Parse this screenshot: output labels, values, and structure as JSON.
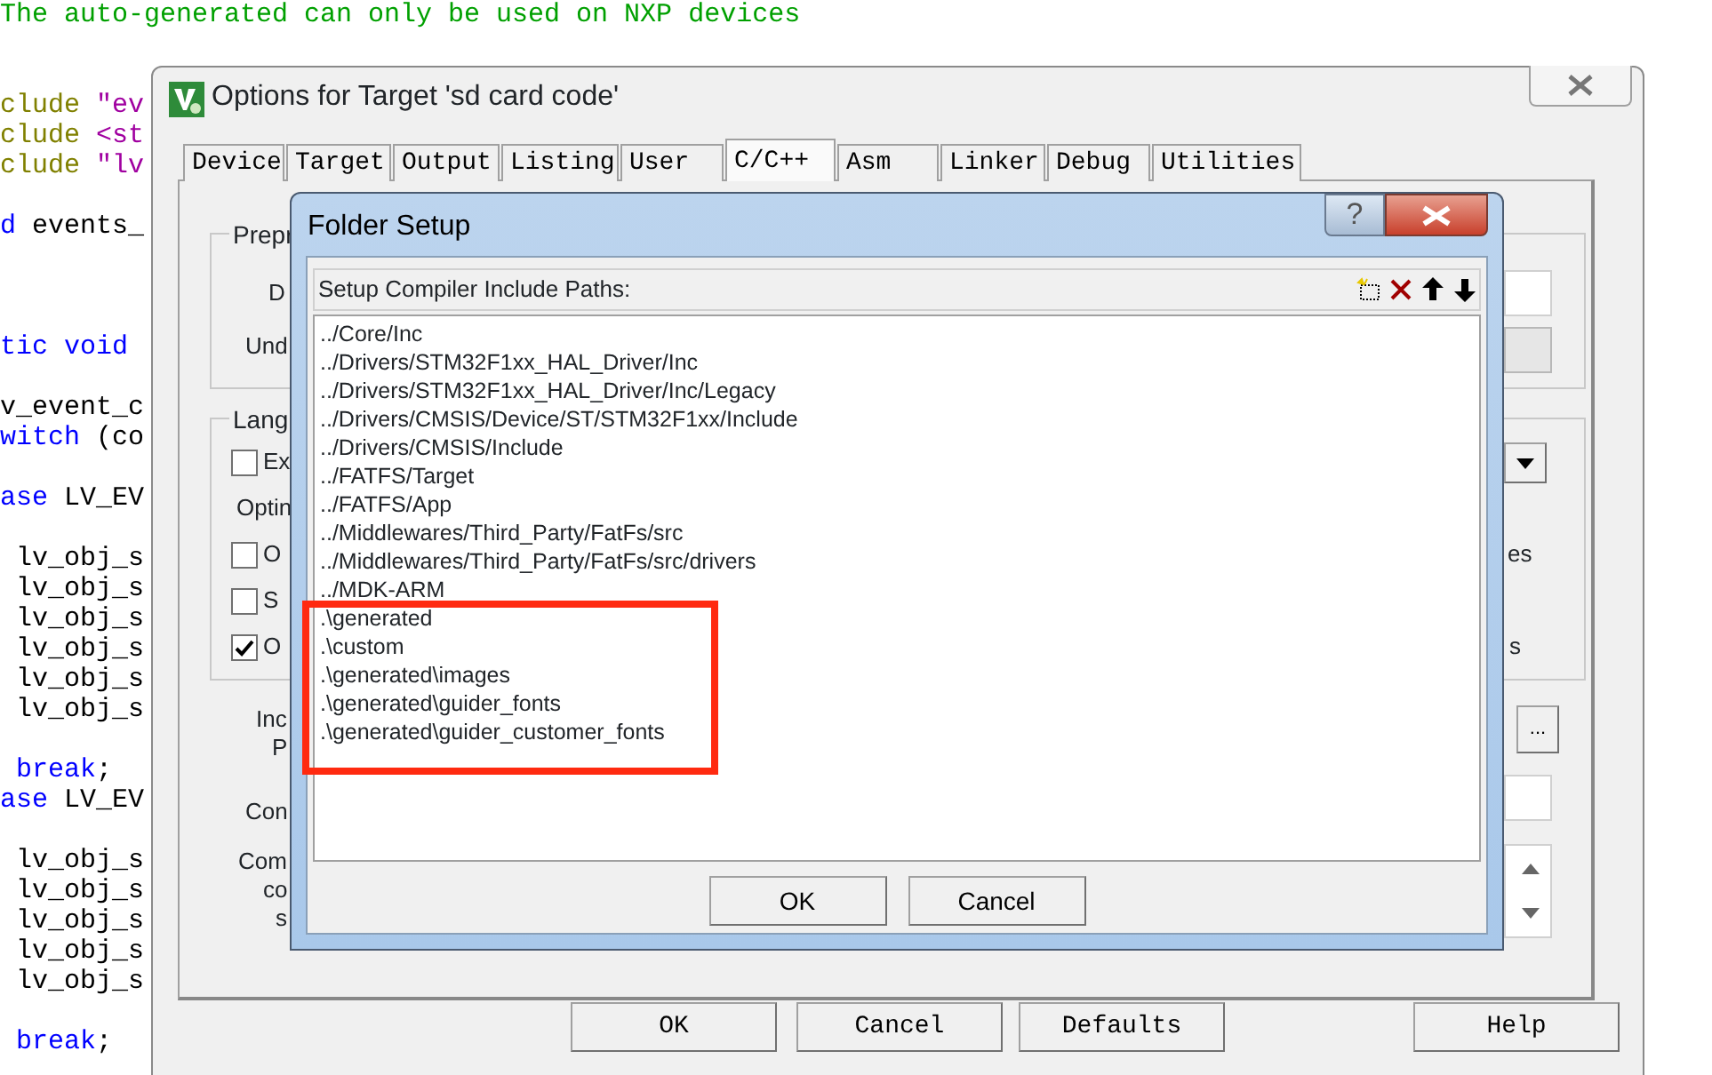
{
  "editor": {
    "lines": [
      {
        "kind": "code",
        "segments": [
          {
            "kind": "comment",
            "text": "The auto-generated can only be used on NXP devices"
          }
        ]
      },
      {
        "kind": "blank"
      },
      {
        "kind": "blank"
      },
      {
        "kind": "code",
        "segments": [
          {
            "kind": "preproc",
            "text": "clude "
          },
          {
            "kind": "string",
            "text": "\"ev"
          }
        ]
      },
      {
        "kind": "code",
        "segments": [
          {
            "kind": "preproc",
            "text": "clude "
          },
          {
            "kind": "string",
            "text": "<st"
          }
        ]
      },
      {
        "kind": "code",
        "segments": [
          {
            "kind": "preproc",
            "text": "clude "
          },
          {
            "kind": "string",
            "text": "\"lv"
          }
        ]
      },
      {
        "kind": "blank"
      },
      {
        "kind": "code",
        "segments": [
          {
            "kind": "keyword",
            "text": "d "
          },
          {
            "kind": "plain",
            "text": "events_"
          }
        ]
      },
      {
        "kind": "blank"
      },
      {
        "kind": "blank"
      },
      {
        "kind": "blank"
      },
      {
        "kind": "code",
        "segments": [
          {
            "kind": "keyword",
            "text": "tic void"
          }
        ]
      },
      {
        "kind": "blank"
      },
      {
        "kind": "code",
        "segments": [
          {
            "kind": "plain",
            "text": "v_event_c"
          }
        ]
      },
      {
        "kind": "code",
        "segments": [
          {
            "kind": "keyword",
            "text": "witch"
          },
          {
            "kind": "plain",
            "text": " (co"
          }
        ]
      },
      {
        "kind": "blank"
      },
      {
        "kind": "code",
        "segments": [
          {
            "kind": "keyword",
            "text": "ase"
          },
          {
            "kind": "plain",
            "text": " LV_EV"
          }
        ]
      },
      {
        "kind": "blank"
      },
      {
        "kind": "code",
        "segments": [
          {
            "kind": "plain",
            "text": " lv_obj_s"
          }
        ]
      },
      {
        "kind": "code",
        "segments": [
          {
            "kind": "plain",
            "text": " lv_obj_s"
          }
        ]
      },
      {
        "kind": "code",
        "segments": [
          {
            "kind": "plain",
            "text": " lv_obj_s"
          }
        ]
      },
      {
        "kind": "code",
        "segments": [
          {
            "kind": "plain",
            "text": " lv_obj_s"
          }
        ]
      },
      {
        "kind": "code",
        "segments": [
          {
            "kind": "plain",
            "text": " lv_obj_s"
          }
        ]
      },
      {
        "kind": "code",
        "segments": [
          {
            "kind": "plain",
            "text": " lv_obj_s"
          }
        ]
      },
      {
        "kind": "blank"
      },
      {
        "kind": "code",
        "segments": [
          {
            "kind": "keyword",
            "text": " break"
          },
          {
            "kind": "plain",
            "text": ";"
          }
        ]
      },
      {
        "kind": "code",
        "segments": [
          {
            "kind": "keyword",
            "text": "ase"
          },
          {
            "kind": "plain",
            "text": " LV_EV"
          }
        ]
      },
      {
        "kind": "blank"
      },
      {
        "kind": "code",
        "segments": [
          {
            "kind": "plain",
            "text": " lv_obj_s"
          }
        ]
      },
      {
        "kind": "code",
        "segments": [
          {
            "kind": "plain",
            "text": " lv_obj_s"
          }
        ]
      },
      {
        "kind": "code",
        "segments": [
          {
            "kind": "plain",
            "text": " lv_obj_s"
          }
        ]
      },
      {
        "kind": "code",
        "segments": [
          {
            "kind": "plain",
            "text": " lv_obj_s"
          }
        ]
      },
      {
        "kind": "code",
        "segments": [
          {
            "kind": "plain",
            "text": " lv_obj_s"
          }
        ]
      },
      {
        "kind": "blank"
      },
      {
        "kind": "code",
        "segments": [
          {
            "kind": "keyword",
            "text": " break"
          },
          {
            "kind": "plain",
            "text": ";"
          }
        ]
      }
    ]
  },
  "options_dialog": {
    "title": "Options for Target 'sd card code'",
    "tabs": [
      {
        "label": "Device",
        "selected": false
      },
      {
        "label": "Target",
        "selected": false
      },
      {
        "label": "Output",
        "selected": false
      },
      {
        "label": "Listing",
        "selected": false
      },
      {
        "label": "User",
        "selected": false
      },
      {
        "label": "C/C++",
        "selected": true
      },
      {
        "label": "Asm",
        "selected": false
      },
      {
        "label": "Linker",
        "selected": false
      },
      {
        "label": "Debug",
        "selected": false
      },
      {
        "label": "Utilities",
        "selected": false
      }
    ],
    "panel_items": [
      {
        "kind": "group",
        "label": "Prepr"
      },
      {
        "kind": "label",
        "text": "D"
      },
      {
        "kind": "label",
        "text": "Und"
      },
      {
        "kind": "group",
        "label": "Lang"
      },
      {
        "kind": "checkbox",
        "label": "Ex",
        "checked": false
      },
      {
        "kind": "label",
        "text": "Optin"
      },
      {
        "kind": "checkbox",
        "label": "O",
        "checked": false
      },
      {
        "kind": "checkbox",
        "label": "S",
        "checked": false
      },
      {
        "kind": "checkbox",
        "label": "O",
        "checked": true
      },
      {
        "kind": "label",
        "text": "Inc"
      },
      {
        "kind": "label",
        "text": "P"
      },
      {
        "kind": "label",
        "text": "Con"
      },
      {
        "kind": "label",
        "text": "Com"
      },
      {
        "kind": "label",
        "text": "co"
      },
      {
        "kind": "label",
        "text": "s"
      },
      {
        "kind": "field",
        "disabled": false
      },
      {
        "kind": "field",
        "disabled": true
      },
      {
        "kind": "dropdown"
      },
      {
        "kind": "label",
        "text": "es"
      },
      {
        "kind": "label",
        "text": "s"
      },
      {
        "kind": "button",
        "text": "..."
      },
      {
        "kind": "field",
        "disabled": false
      },
      {
        "kind": "spin"
      }
    ],
    "buttons": [
      "OK",
      "Cancel",
      "Defaults",
      "Help"
    ]
  },
  "folder_setup": {
    "title": "Folder Setup",
    "help_button": "?",
    "header": "Setup Compiler Include Paths:",
    "paths": [
      "../Core/Inc",
      "../Drivers/STM32F1xx_HAL_Driver/Inc",
      "../Drivers/STM32F1xx_HAL_Driver/Inc/Legacy",
      "../Drivers/CMSIS/Device/ST/STM32F1xx/Include",
      "../Drivers/CMSIS/Include",
      "../FATFS/Target",
      "../FATFS/App",
      "../Middlewares/Third_Party/FatFs/src",
      "../Middlewares/Third_Party/FatFs/src/drivers",
      "../MDK-ARM",
      ".\\generated",
      ".\\custom",
      ".\\generated\\images",
      ".\\generated\\guider_fonts",
      ".\\generated\\guider_customer_fonts"
    ],
    "buttons": [
      "OK",
      "Cancel"
    ]
  }
}
